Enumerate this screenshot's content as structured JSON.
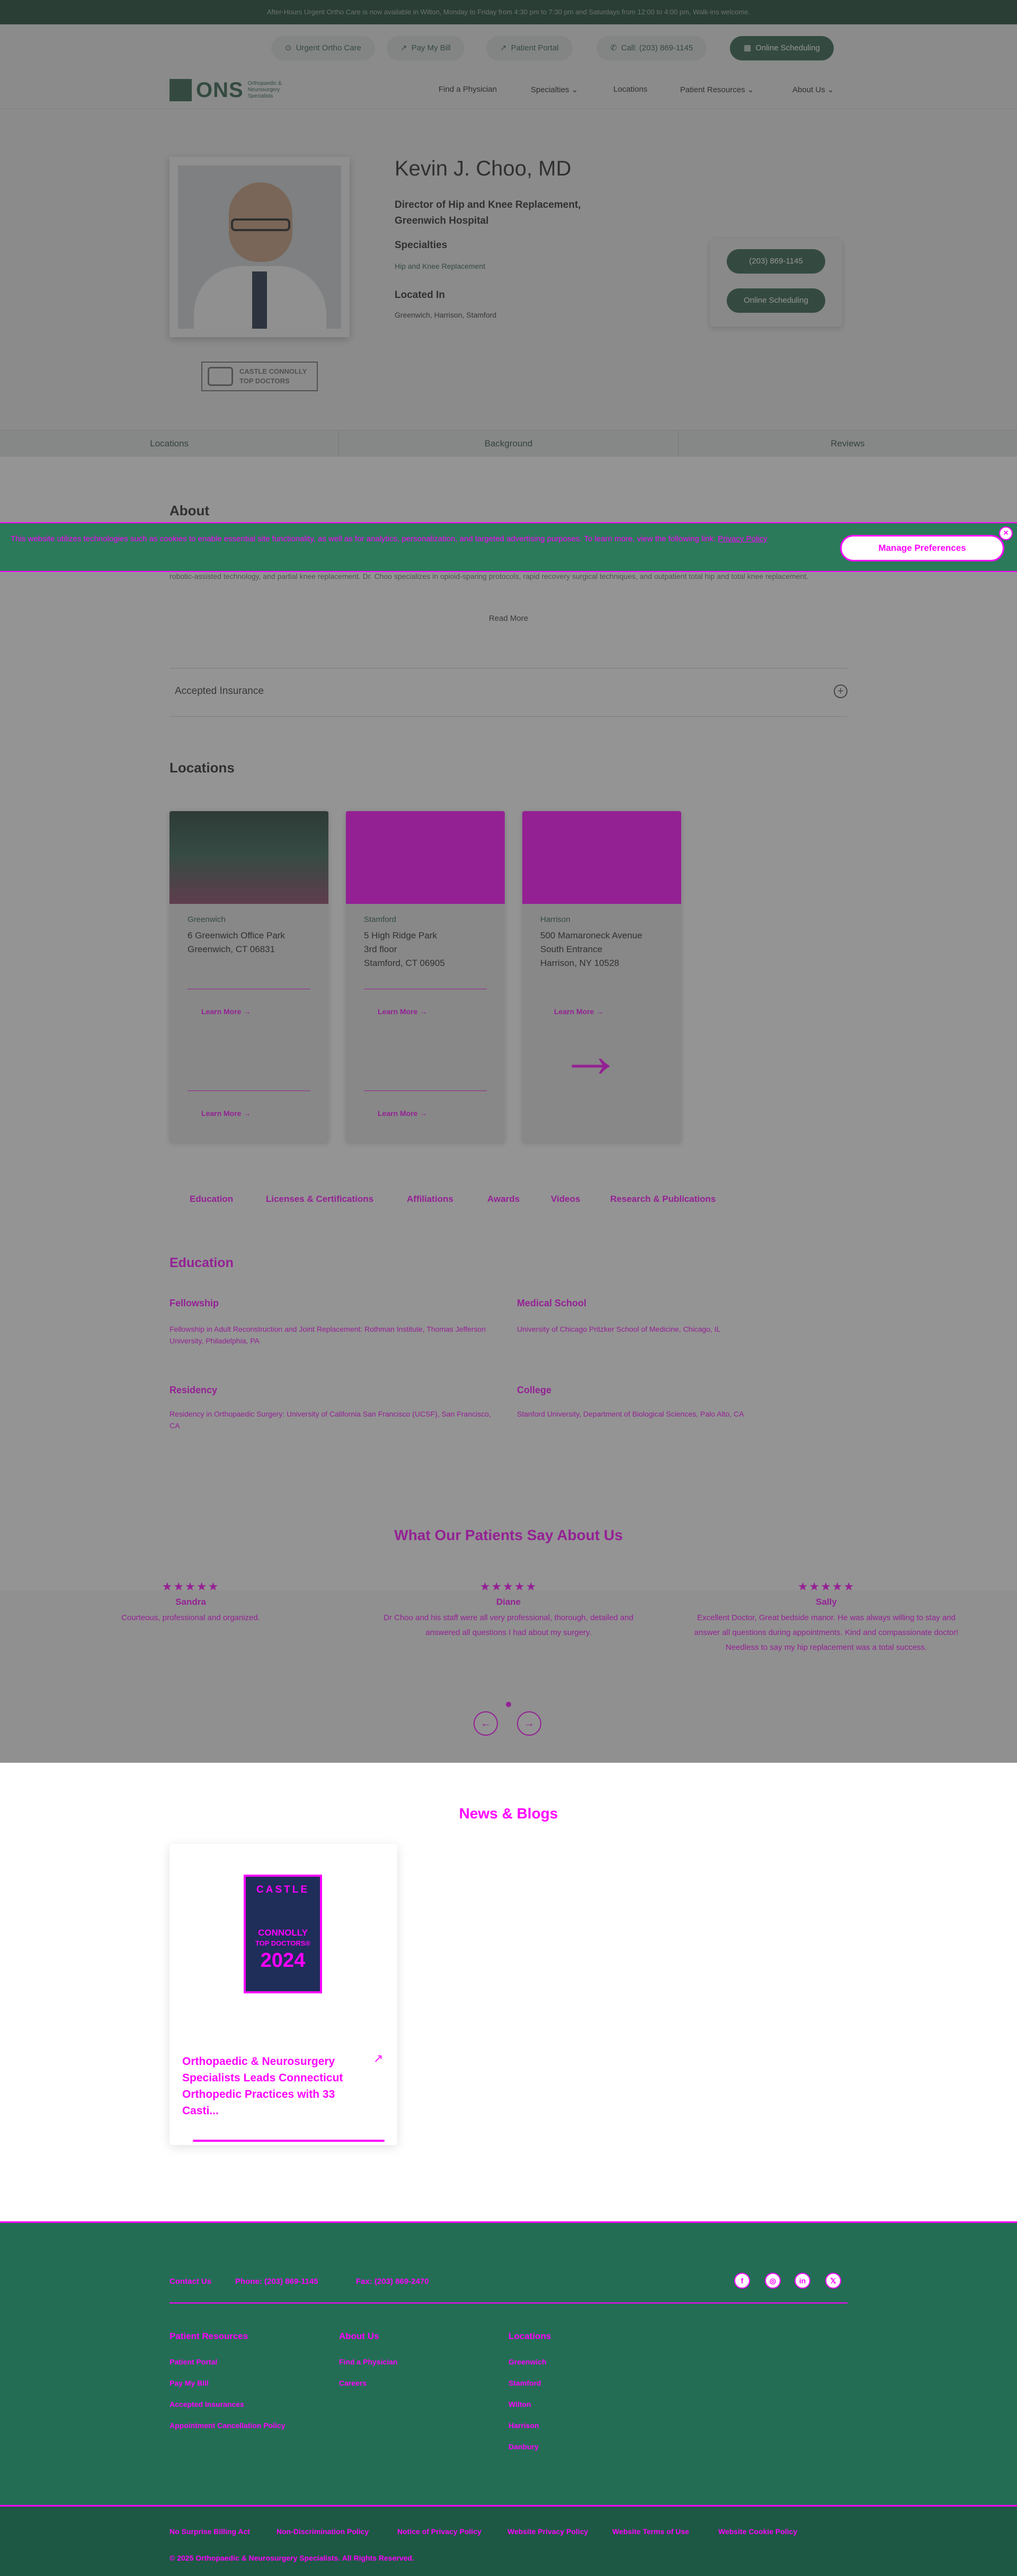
{
  "announcement": "After-Hours Urgent Ortho Care is now available in Wilton, Monday to Friday from 4:30 pm to 7:30 pm and Saturdays from 12:00 to 4:00 pm, Walk-ins welcome.",
  "utility": {
    "urgent": "Urgent Ortho Care",
    "pay": "Pay My Bill",
    "portal": "Patient Portal",
    "call": "Call: (203) 869-1145",
    "online": "Online Scheduling"
  },
  "brand": {
    "logo_text": "ONS",
    "logo_sub": "Orthopaedic & Neurosurgery Specialists"
  },
  "nav": {
    "find": "Find a Physician",
    "specialties": "Specialties",
    "locations": "Locations",
    "resources": "Patient Resources",
    "about": "About Us"
  },
  "profile": {
    "name": "Kevin J. Choo, MD",
    "title": "Director of Hip and Knee Replacement, Greenwich Hospital",
    "specialties_label": "Specialties",
    "specialties_value": "Hip and Knee Replacement",
    "located_label": "Located In",
    "located_value": "Greenwich, Harrison, Stamford",
    "phone_btn": "(203) 869-1145",
    "schedule_btn": "Online Scheduling",
    "badge_text": "CASTLE CONNOLLY TOP DOCTORS"
  },
  "tabs": [
    "Locations",
    "Background",
    "Reviews"
  ],
  "about": {
    "heading": "About",
    "text": "robotic-assisted technology, and partial knee replacement. Dr. Choo specializes in opioid-sparing protocols, rapid recovery surgical techniques, and outpatient total hip and total knee replacement.",
    "read_more": "Read More"
  },
  "cookie": {
    "text": "This website utilizes technologies such as cookies to enable essential site functionality, as well as for analytics, personalization, and targeted advertising purposes. To learn more, view the following link:",
    "link": "Privacy Policy",
    "button": "Manage Preferences",
    "close": "×"
  },
  "insurance": {
    "label": "Accepted Insurance",
    "icon": "+"
  },
  "locations": {
    "heading": "Locations",
    "cards": [
      {
        "city": "Greenwich",
        "addr1": "6 Greenwich Office Park",
        "addr2": "Greenwich, CT 06831",
        "addr3": "",
        "learn": "Learn More →"
      },
      {
        "city": "Stamford",
        "addr1": "5 High Ridge Park",
        "addr2": "3rd floor",
        "addr3": "Stamford, CT 06905",
        "learn": "Learn More →"
      },
      {
        "city": "Harrison",
        "addr1": "500 Mamaroneck Avenue",
        "addr2": "South Entrance",
        "addr3": "Harrison, NY 10528",
        "learn": "Learn More →"
      }
    ]
  },
  "bio_tabs": [
    "Education",
    "Licenses & Certifications",
    "Affiliations",
    "Awards",
    "Videos",
    "Research & Publications"
  ],
  "education": {
    "heading": "Education",
    "fellowship_label": "Fellowship",
    "fellowship_text": "Fellowship in Adult Reconstruction and Joint Replacement: Rothman Institute, Thomas Jefferson University, Philadelphia, PA",
    "medical_label": "Medical School",
    "medical_text": "University of Chicago Pritzker School of Medicine, Chicago, IL",
    "residency_label": "Residency",
    "residency_text": "Residency in Orthopaedic Surgery: University of California San Francisco (UCSF), San Francisco, CA",
    "college_label": "College",
    "college_text": "Stanford University, Department of Biological Sciences, Palo Alto, CA"
  },
  "testimonials": {
    "heading": "What Our Patients Say About Us",
    "items": [
      {
        "name": "Sandra",
        "text": "Courteous, professional and organized.",
        "stars": "★★★★★"
      },
      {
        "name": "Diane",
        "text": "Dr Choo and his staff were all very professional, thorough, detailed and answered all questions I had about my surgery.",
        "stars": "★★★★★"
      },
      {
        "name": "Sally",
        "text": "Excellent Doctor, Great bedside manor. He was always willing to stay and answer all questions during appointments. Kind and compassionate doctor! Needless to say my hip replacement was a total success.",
        "stars": "★★★★★"
      }
    ],
    "prev": "←",
    "next": "→"
  },
  "news": {
    "heading": "News & Blogs",
    "badge": {
      "l1": "CASTLE",
      "l2": "CONNOLLY",
      "l3": "TOP DOCTORS®",
      "l4": "2024"
    },
    "headline": "Orthopaedic & Neurosurgery Specialists Leads Connecticut Orthopedic Practices with 33 Casti...",
    "arrow": "↗"
  },
  "footer": {
    "contact": "Contact Us",
    "phone": "Phone: (203) 869-1145",
    "fax": "Fax: (203) 869-2470",
    "social": [
      "f",
      "◎",
      "in",
      "𝕏"
    ],
    "col1_head": "Patient Resources",
    "col1": [
      "Patient Portal",
      "Pay My Bill",
      "Accepted Insurances",
      "Appointment Cancellation Policy"
    ],
    "col2_head": "About Us",
    "col2": [
      "Find a Physician",
      "Careers"
    ],
    "col3_head": "Locations",
    "col3": [
      "Greenwich",
      "Stamford",
      "Wilton",
      "Harrison",
      "Danbury"
    ]
  },
  "legal": {
    "links": [
      "No Surprise Billing Act",
      "Non-Discrimination Policy",
      "Notice of Privacy Policy",
      "Website Privacy Policy",
      "Website Terms of Use",
      "Website Cookie Policy"
    ],
    "copyright": "© 2025 Orthopaedic & Neurosurgery Specialists. All Rights Reserved."
  },
  "colors": {
    "brand_green": "#2b5b46",
    "overlay_magenta": "#ff00ff",
    "footer_green": "#246d55"
  }
}
